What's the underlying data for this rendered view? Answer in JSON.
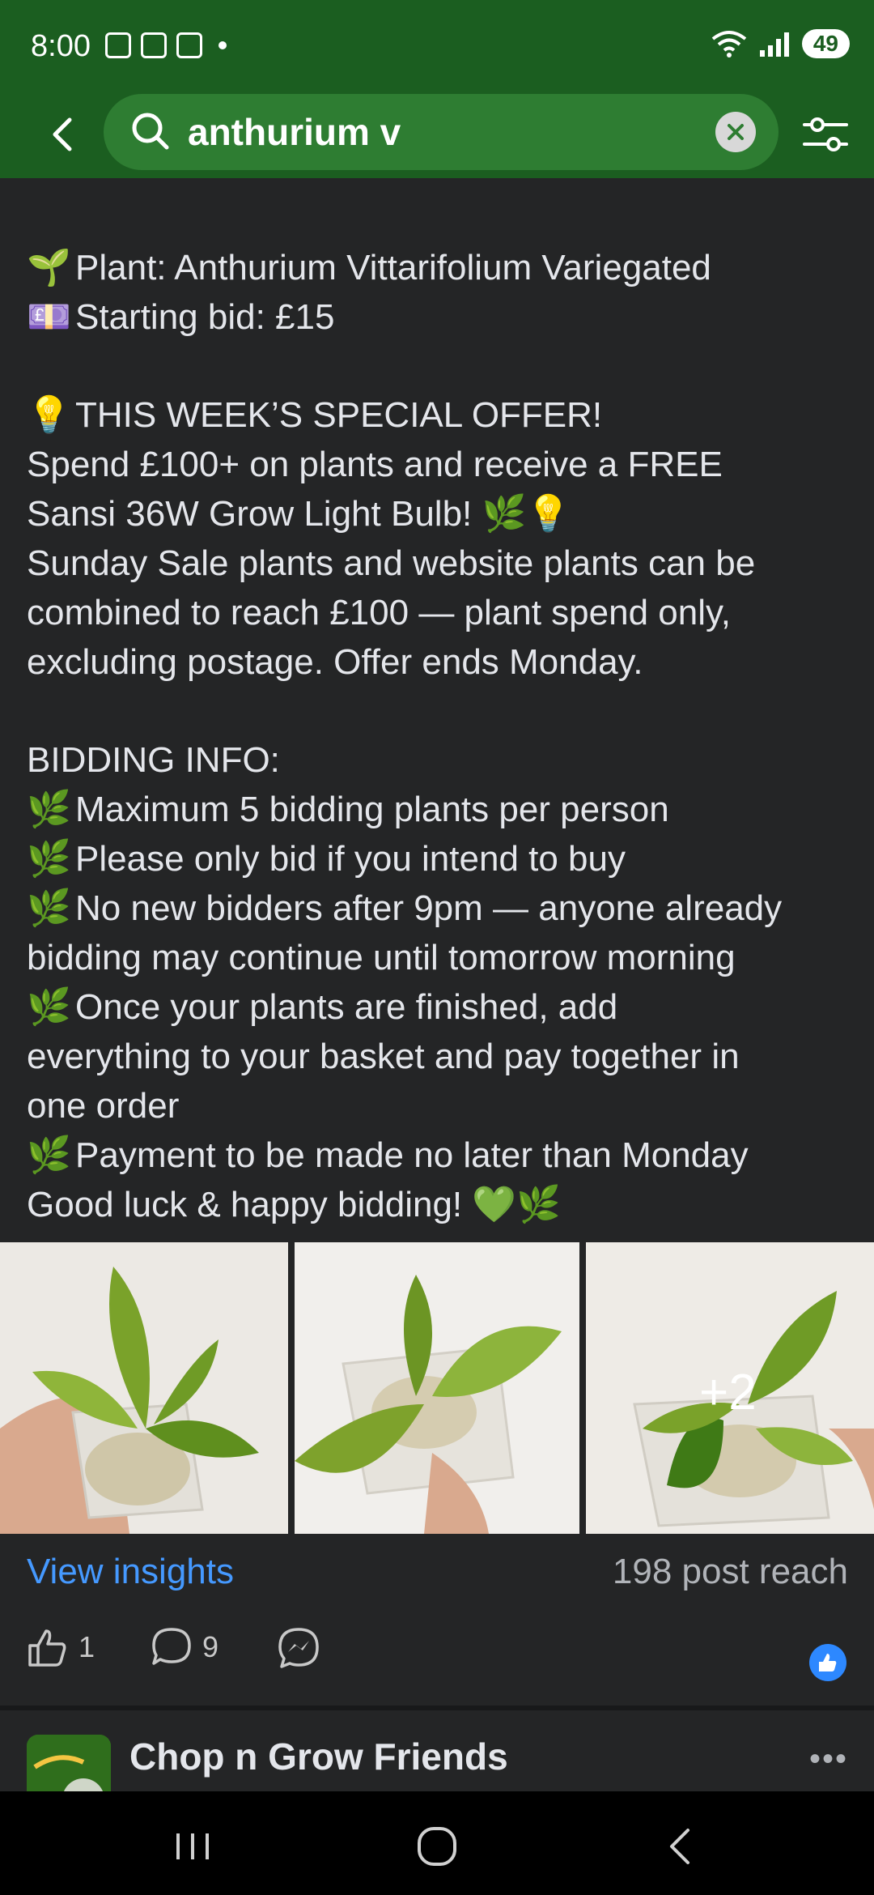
{
  "status_bar": {
    "time": "8:00",
    "battery": "49"
  },
  "search": {
    "query": "anthurium v"
  },
  "post": {
    "lines": [
      {
        "emoji": "🌱",
        "text": "Plant: Anthurium Vittarifolium Variegated"
      },
      {
        "emoji": "💷",
        "text": "Starting bid: £15"
      },
      {
        "emoji": "💡",
        "text": "THIS WEEK’S SPECIAL OFFER!"
      },
      {
        "emoji": "",
        "text": "Spend £100+ on plants and receive a FREE"
      },
      {
        "emoji": "",
        "text": "Sansi 36W Grow Light Bulb! 🌿💡"
      },
      {
        "emoji": "",
        "text": "Sunday Sale plants and website plants can be"
      },
      {
        "emoji": "",
        "text": "combined to reach £100 — plant spend only,"
      },
      {
        "emoji": "",
        "text": "excluding postage. Offer ends Monday."
      },
      {
        "emoji": "",
        "text": "BIDDING INFO:"
      },
      {
        "emoji": "🌿",
        "text": "Maximum 5 bidding plants per person"
      },
      {
        "emoji": "🌿",
        "text": "Please only bid if you intend to buy"
      },
      {
        "emoji": "🌿",
        "text": "No new bidders after 9pm — anyone already"
      },
      {
        "emoji": "",
        "text": "bidding may continue until tomorrow morning"
      },
      {
        "emoji": "🌿",
        "text": "Once your plants are finished, add"
      },
      {
        "emoji": "",
        "text": "everything to your basket and pay together in"
      },
      {
        "emoji": "",
        "text": "one order"
      },
      {
        "emoji": "🌿",
        "text": "Payment to be made no later than Monday"
      },
      {
        "emoji": "",
        "text": "Good luck & happy bidding! 💚🌿"
      }
    ],
    "photos_more": "+2",
    "view_insights": "View insights",
    "reach": "198 post reach",
    "likes": "1",
    "comments": "9"
  },
  "next_post": {
    "group_name": "Chop n Grow Friends"
  }
}
